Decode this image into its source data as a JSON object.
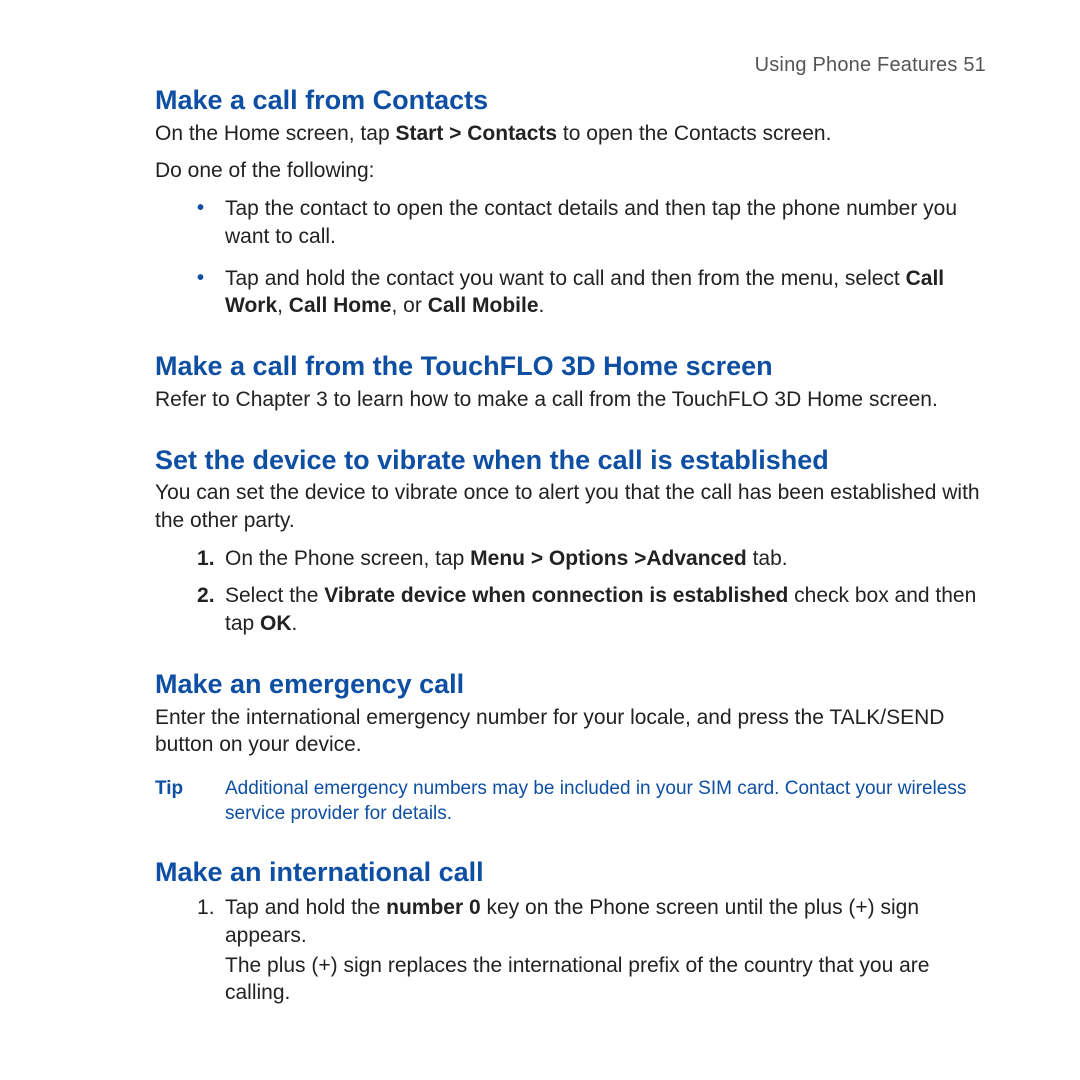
{
  "header": {
    "running_head": "Using Phone Features  51"
  },
  "sections": {
    "contacts": {
      "heading": "Make a call from Contacts",
      "intro_1a": "On the Home screen, tap ",
      "intro_1b": "Start > Contacts",
      "intro_1c": " to open the Contacts screen.",
      "intro_2": "Do one of the following:",
      "bullet1": "Tap the contact to open the contact details and then tap the phone number you want to call.",
      "bullet2a": "Tap and hold the contact you want to call and then from the menu, select ",
      "bullet2b": "Call Work",
      "bullet2c": ", ",
      "bullet2d": "Call Home",
      "bullet2e": ", or ",
      "bullet2f": "Call Mobile",
      "bullet2g": "."
    },
    "touchflo": {
      "heading": "Make a call from the TouchFLO 3D Home screen",
      "body": "Refer to Chapter 3 to learn how to make a call from the TouchFLO 3D Home screen."
    },
    "vibrate": {
      "heading": "Set the device to vibrate when the call is established",
      "body": "You can set the device to vibrate once to alert you that the call has been established with the other party.",
      "step1a": "On the Phone screen, tap ",
      "step1b": "Menu > Options >Advanced",
      "step1c": " tab.",
      "step2a": "Select the ",
      "step2b": "Vibrate device when connection is established",
      "step2c": " check box and then tap ",
      "step2d": "OK",
      "step2e": "."
    },
    "emergency": {
      "heading": "Make an emergency call",
      "body": "Enter the international emergency number for your locale, and press the TALK/SEND button on your device.",
      "tip_label": "Tip",
      "tip_body": "Additional emergency numbers may be included in your SIM card. Contact your wireless service provider for details."
    },
    "international": {
      "heading": "Make an international call",
      "step1a": "Tap and hold the ",
      "step1b": "number 0",
      "step1c": " key on the Phone screen until the plus (+) sign appears.",
      "step1_note": "The plus (+) sign replaces the international prefix of the country that you are calling."
    }
  }
}
